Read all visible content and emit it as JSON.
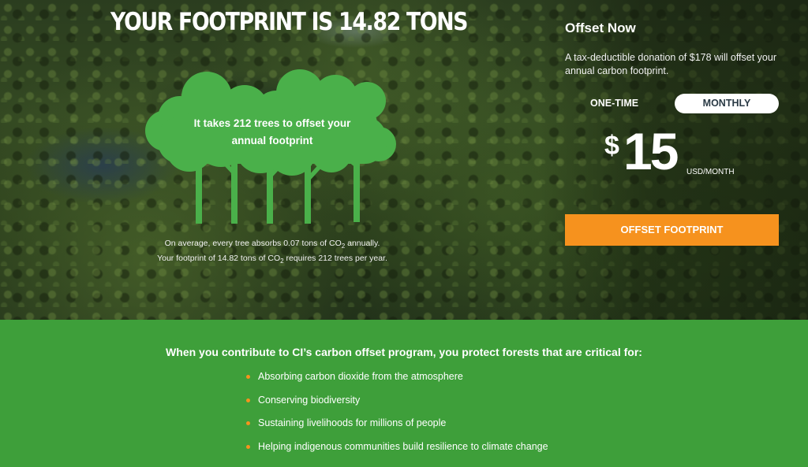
{
  "hero": {
    "headline": "YOUR FOOTPRINT IS 14.82 TONS",
    "trees_caption_line1": "It takes 212 trees to offset your",
    "trees_caption_line2": "annual footprint",
    "note1_pre": "On average, every tree absorbs 0.07 tons of CO",
    "note1_sub": "2",
    "note1_post": " annually.",
    "note2_pre": "Your footprint of 14.82 tons of CO",
    "note2_sub": "2",
    "note2_post": " requires 212 trees per year."
  },
  "offset": {
    "title": "Offset Now",
    "description": "A tax-deductible donation of $178 will offset your annual carbon footprint.",
    "frequency": {
      "options": [
        "ONE-TIME",
        "MONTHLY"
      ],
      "selected": "MONTHLY"
    },
    "price": {
      "currency_symbol": "$",
      "amount": "15",
      "unit": "USD/MONTH"
    },
    "cta_label": "OFFSET FOOTPRINT"
  },
  "benefits": {
    "title": "When you contribute to CI’s carbon offset program, you protect forests that are critical for:",
    "items": [
      "Absorbing carbon dioxide from the atmosphere",
      "Conserving biodiversity",
      "Sustaining livelihoods for millions of people",
      "Helping indigenous communities build resilience to climate change"
    ]
  },
  "colors": {
    "tree_green": "#4ab04a",
    "section_green": "#3e9f3a",
    "accent_orange": "#f6921e",
    "toggle_text": "#2a3a45"
  },
  "icons": {
    "trees": "trees-illustration-icon",
    "bullet": "bullet-dot-icon"
  }
}
